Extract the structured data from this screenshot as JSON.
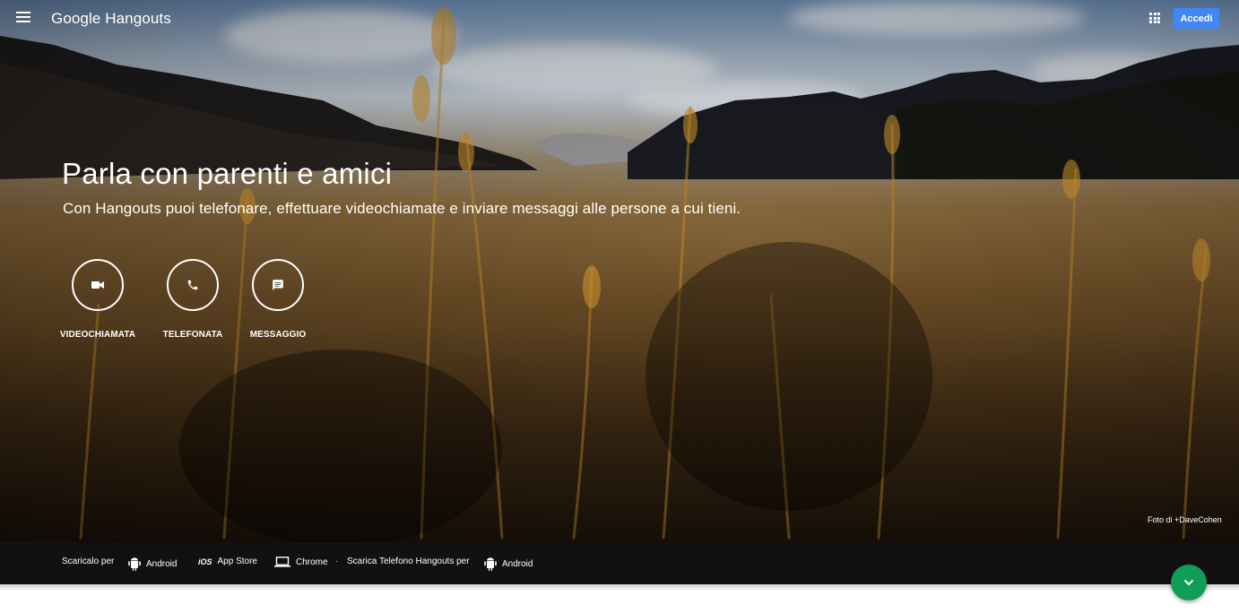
{
  "header": {
    "logo_text": "Google Hangouts",
    "signin_label": "Accedi"
  },
  "hero": {
    "headline": "Parla con parenti e amici",
    "subheadline": "Con Hangouts puoi telefonare, effettuare videochiamate e inviare messaggi alle persone a cui tieni.",
    "actions": [
      {
        "label": "VIDEOCHIAMATA",
        "icon": "videocam-icon"
      },
      {
        "label": "TELEFONATA",
        "icon": "phone-icon"
      },
      {
        "label": "MESSAGGIO",
        "icon": "chat-icon"
      }
    ],
    "photo_credit": "Foto di +DaveCohen"
  },
  "download_bar": {
    "lead_text": "Scaricalo per",
    "links": [
      {
        "label": "Android",
        "icon": "android-icon"
      },
      {
        "label": "App Store",
        "icon": "ios-icon",
        "icon_text": "iOS"
      },
      {
        "label": "Chrome",
        "icon": "laptop-icon"
      }
    ],
    "separator": "·",
    "phone_text": "Scarica Telefono Hangouts per",
    "phone_link": {
      "label": "Android",
      "icon": "android-icon"
    }
  },
  "fab": {
    "icon": "chevron-down-icon"
  },
  "colors": {
    "accent": "#4285f4",
    "fab": "#0f9d58",
    "download_bar": "#111111"
  }
}
